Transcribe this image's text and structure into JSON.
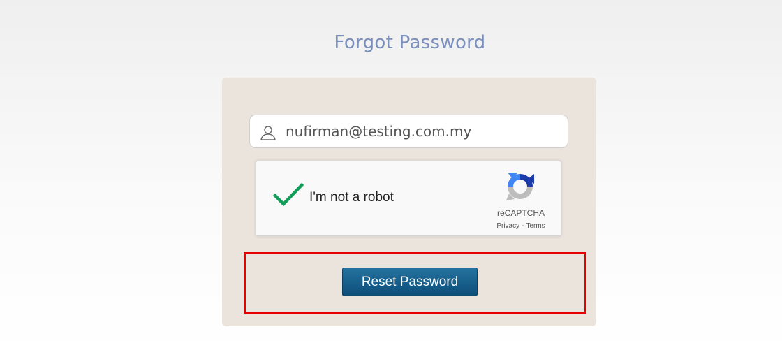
{
  "page": {
    "title": "Forgot Password"
  },
  "form": {
    "email_value": "nufirman@testing.com.my",
    "email_icon": "user-icon",
    "submit_label": "Reset Password"
  },
  "captcha": {
    "label": "I'm not a robot",
    "checked": true,
    "brand": "reCAPTCHA",
    "privacy_link": "Privacy",
    "separator": "-",
    "terms_link": "Terms"
  },
  "colors": {
    "title": "#7b8fbd",
    "card_background": "#ebe4dd",
    "check_mark": "#0f9d58",
    "button": "#0d4e78",
    "highlight": "#e60000"
  }
}
